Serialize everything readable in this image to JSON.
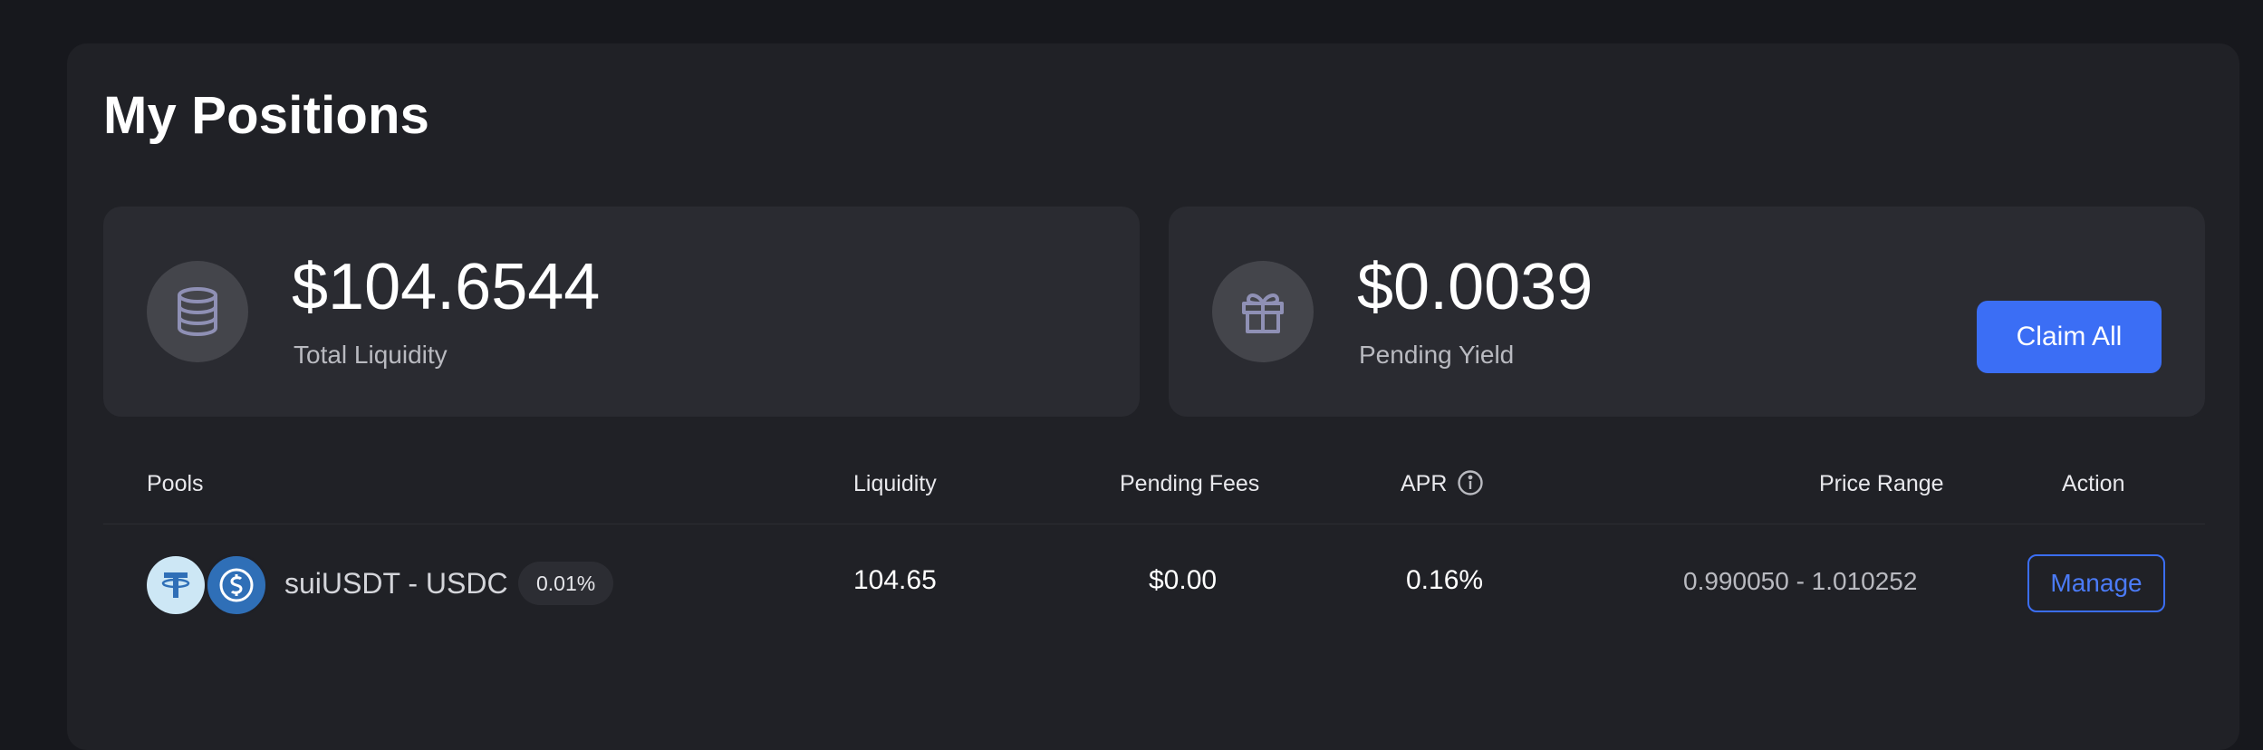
{
  "page": {
    "title": "My Positions"
  },
  "summary": {
    "total_liquidity": {
      "value": "$104.6544",
      "label": "Total Liquidity",
      "icon": "database-icon"
    },
    "pending_yield": {
      "value": "$0.0039",
      "label": "Pending Yield",
      "icon": "gift-icon"
    },
    "claim_label": "Claim All"
  },
  "table": {
    "headers": {
      "pools": "Pools",
      "liquidity": "Liquidity",
      "pending_fees": "Pending Fees",
      "apr": "APR",
      "price_range": "Price Range",
      "action": "Action"
    },
    "rows": [
      {
        "token_a": "suiUSDT",
        "separator": "-",
        "token_b": "USDC",
        "fee_tier": "0.01%",
        "liquidity": "104.65",
        "pending_fees": "$0.00",
        "apr": "0.16%",
        "price_range": "0.990050 - 1.010252",
        "action_label": "Manage"
      }
    ]
  },
  "colors": {
    "background": "#17181d",
    "panel": "#202126",
    "card": "#2a2b31",
    "accent": "#3b6ef5"
  }
}
